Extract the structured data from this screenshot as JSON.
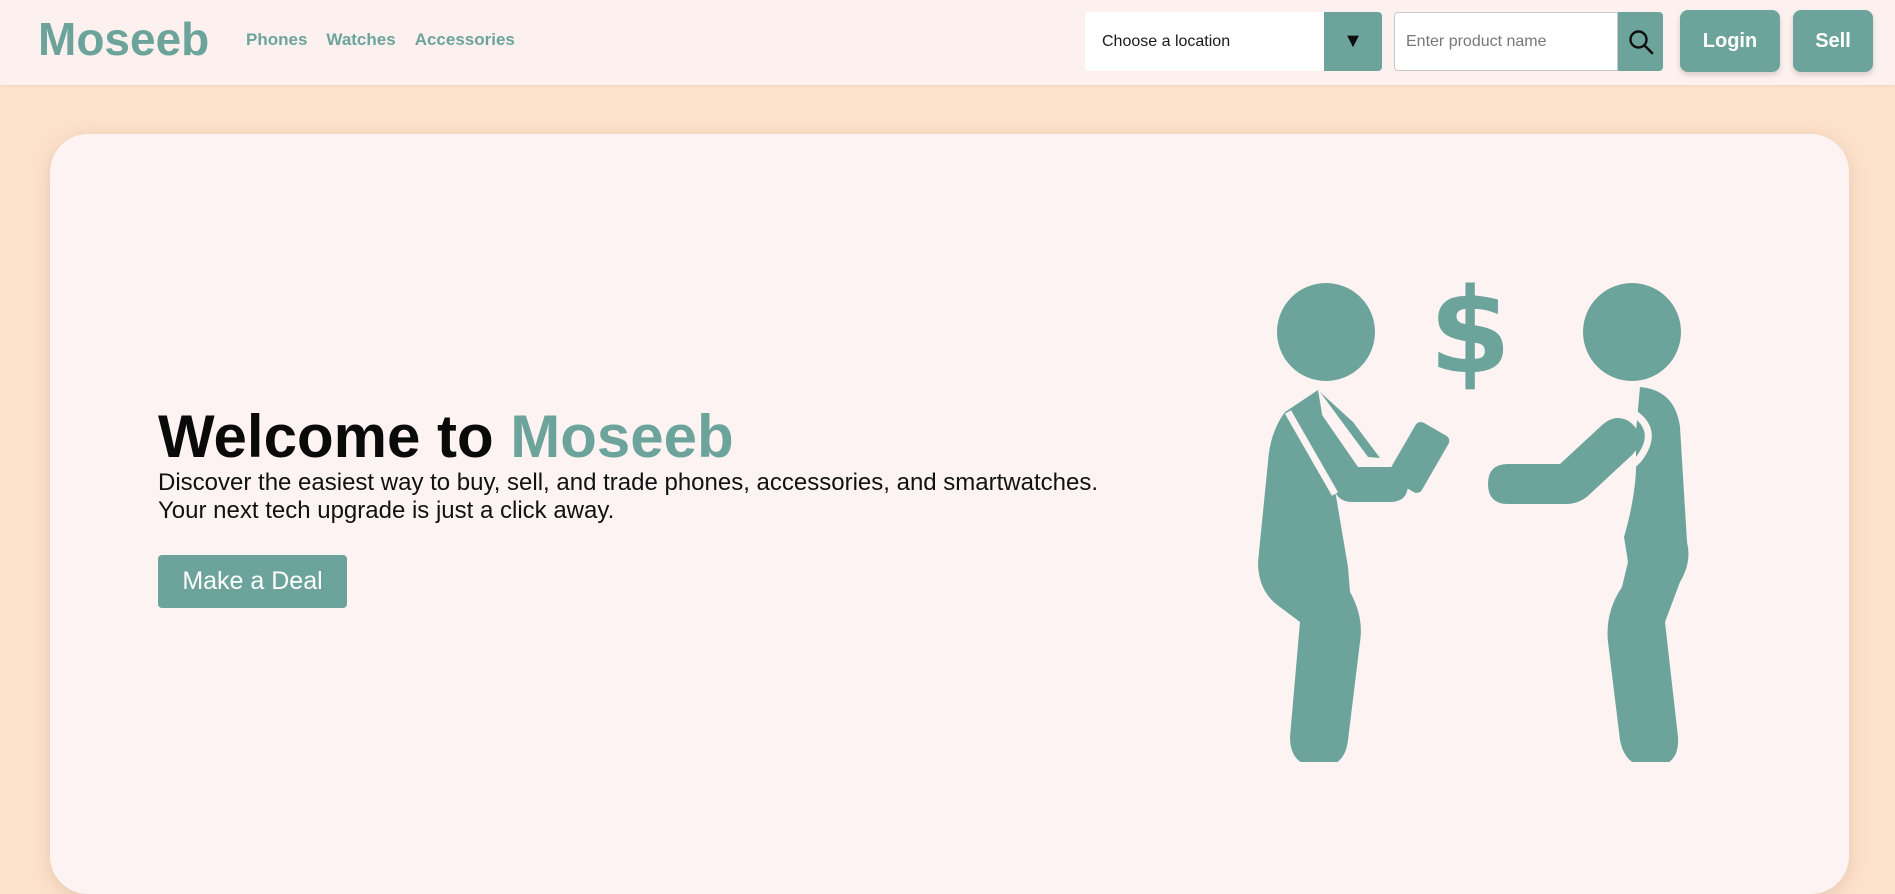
{
  "header": {
    "logo": "Moseeb",
    "nav": [
      "Phones",
      "Watches",
      "Accessories"
    ],
    "location": {
      "value": "Choose a location",
      "arrow": "▼"
    },
    "search": {
      "placeholder": "Enter product name",
      "icon": "search-icon"
    },
    "login_label": "Login",
    "sell_label": "Sell"
  },
  "hero": {
    "title_prefix": "Welcome to ",
    "title_brand": "Moseeb",
    "description_line1": "Discover the easiest way to buy, sell, and trade phones, accessories, and smartwatches.",
    "description_line2": "Your next tech upgrade is just a click away.",
    "cta_label": "Make a Deal",
    "illustration_icon": "trade-people-icon"
  },
  "colors": {
    "accent": "#6ca49b",
    "page_background": "#fde2cb",
    "card_background": "#fcf3f2",
    "header_background": "#fdf1ef"
  }
}
